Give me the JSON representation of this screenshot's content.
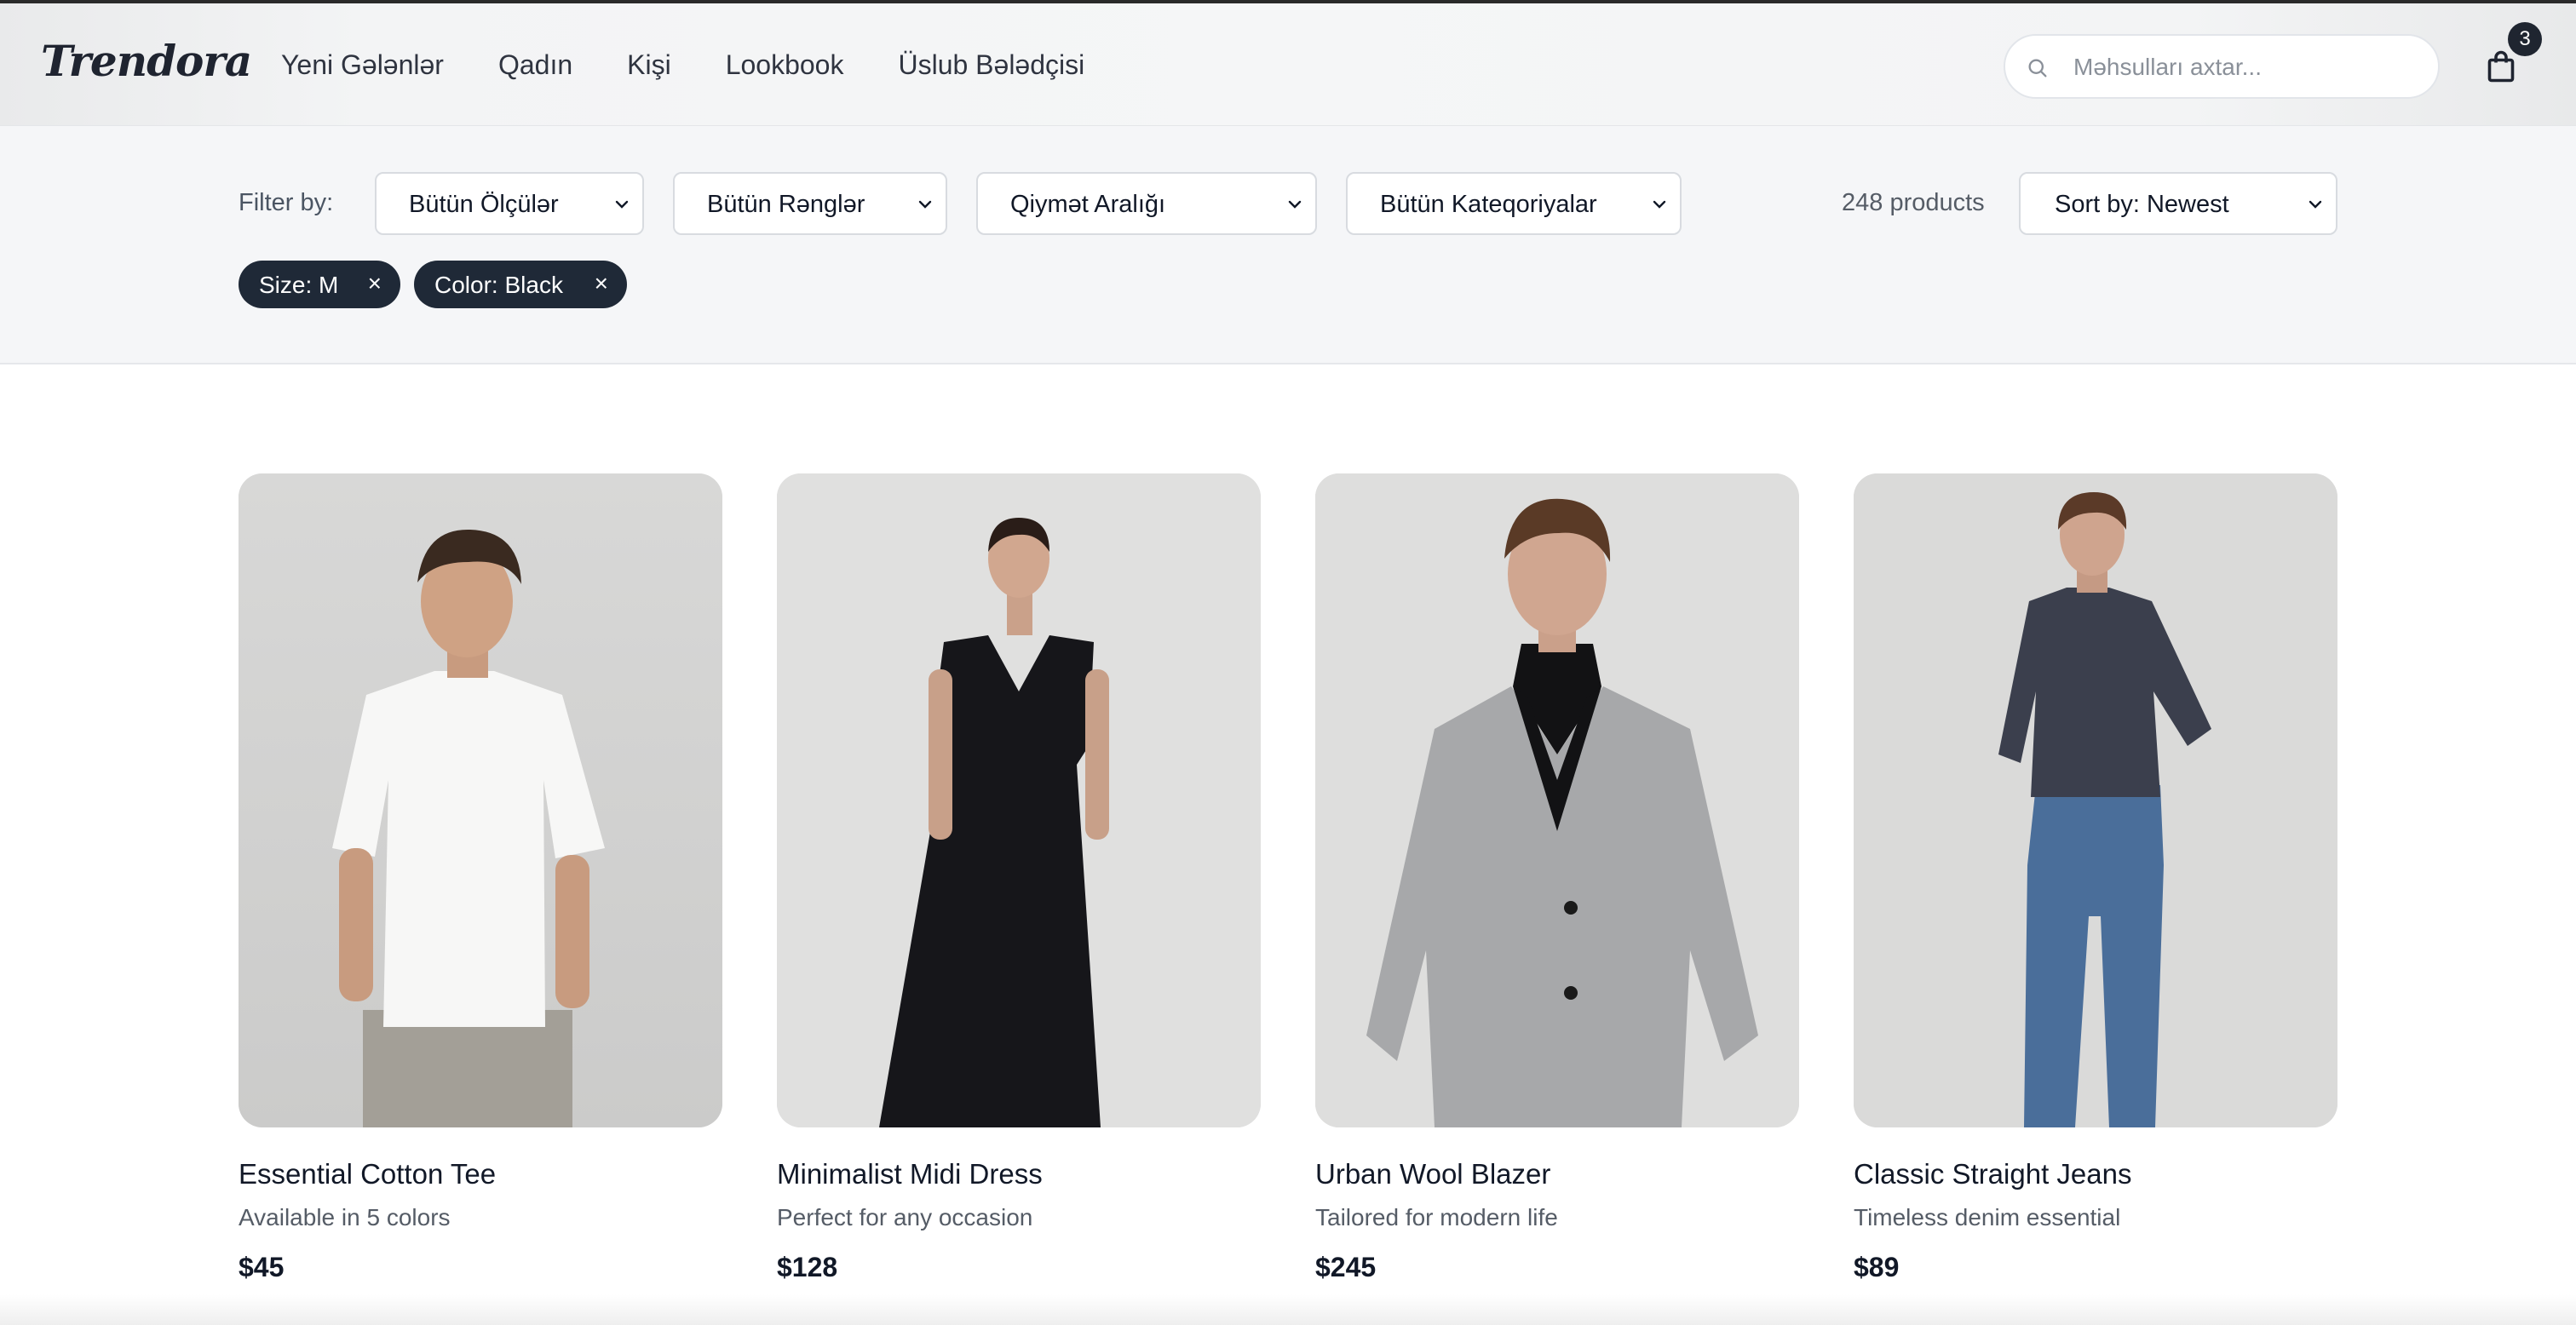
{
  "brand": {
    "logo": "Trendora"
  },
  "nav": [
    {
      "label": "Yeni Gələnlər"
    },
    {
      "label": "Qadın"
    },
    {
      "label": "Kişi"
    },
    {
      "label": "Lookbook"
    },
    {
      "label": "Üslub Bələdçisi"
    }
  ],
  "search": {
    "placeholder": "Məhsulları axtar...",
    "icon": "search-icon"
  },
  "cart": {
    "icon": "shopping-bag-icon",
    "count": "3"
  },
  "filters": {
    "label": "Filter by:",
    "size": "Bütün Ölçülər",
    "color": "Bütün Rənglər",
    "price": "Qiymət Aralığı",
    "category": "Bütün Kateqoriyalar",
    "product_count": "248 products",
    "sort": "Sort by: Newest",
    "active": [
      {
        "label": "Size: M",
        "remove": "×"
      },
      {
        "label": "Color: Black",
        "remove": "×"
      }
    ]
  },
  "products": [
    {
      "name": "Essential Cotton Tee",
      "description": "Available in 5 colors",
      "price": "$45"
    },
    {
      "name": "Minimalist Midi Dress",
      "description": "Perfect for any occasion",
      "price": "$128"
    },
    {
      "name": "Urban Wool Blazer",
      "description": "Tailored for modern life",
      "price": "$245"
    },
    {
      "name": "Classic Straight Jeans",
      "description": "Timeless denim essential",
      "price": "$89"
    }
  ],
  "colors": {
    "accent": "#1f2937",
    "page_bg": "#ffffff",
    "filter_bg": "#f5f6f8"
  }
}
